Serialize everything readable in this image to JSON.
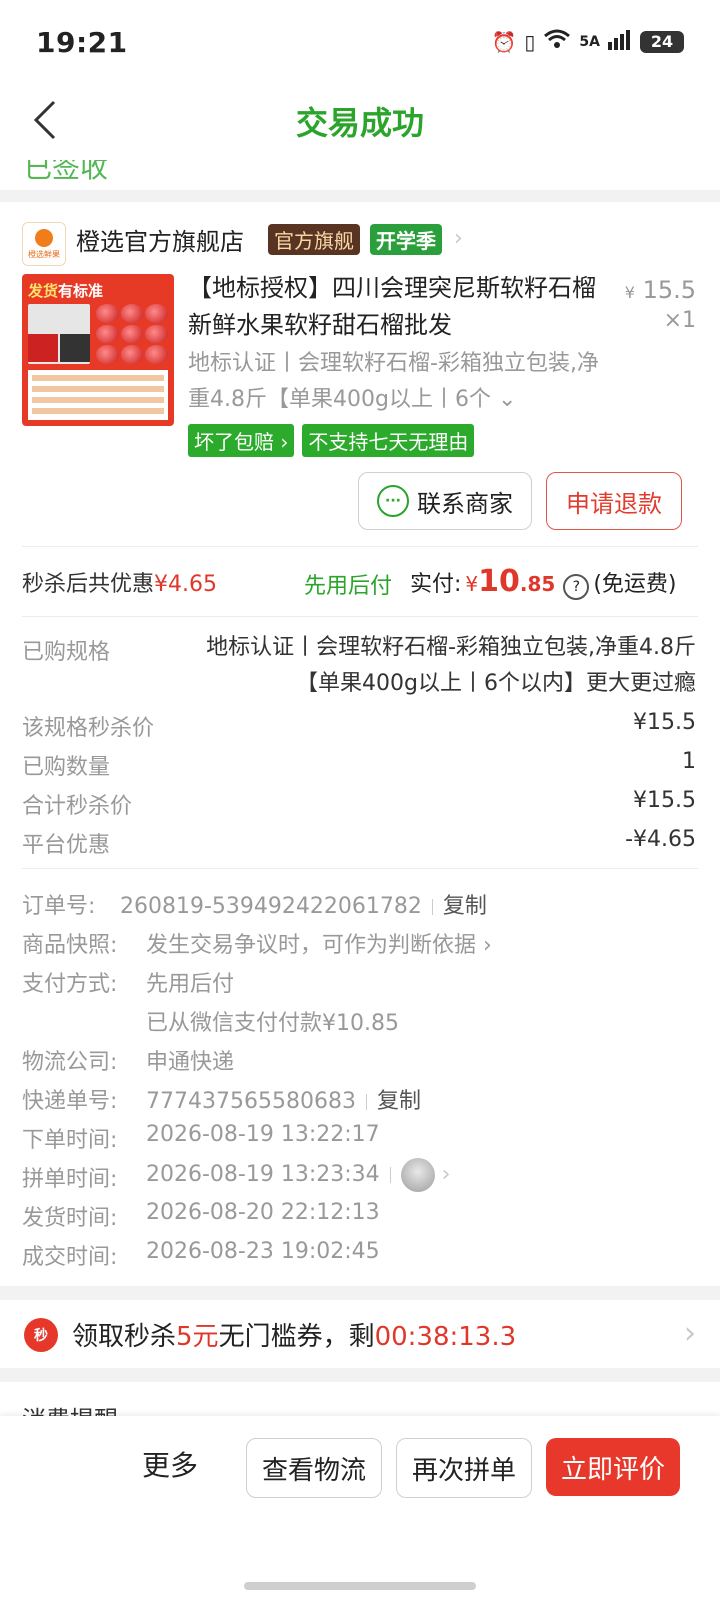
{
  "status_bar": {
    "time": "19:21",
    "network": "5A",
    "battery": "24"
  },
  "header": {
    "title": "交易成功",
    "peek_text": "已签收"
  },
  "store": {
    "logo_text": "橙选鲜果",
    "name": "橙选官方旗舰店",
    "badges": [
      "官方旗舰",
      "开学季"
    ]
  },
  "product": {
    "image_caption_a": "发货",
    "image_caption_b": "有标准",
    "title": "【地标授权】四川会理突尼斯软籽石榴新鲜水果软籽甜石榴批发",
    "price_symbol": "¥",
    "price": "15.5",
    "qty": "×1",
    "spec": "地标认证丨会理软籽石榴-彩箱独立包装,净重4.8斤【单果400g以上丨6个",
    "tags": [
      "坏了包赔 ›",
      "不支持七天无理由"
    ]
  },
  "actions": {
    "contact": "联系商家",
    "refund": "申请退款"
  },
  "summary": {
    "discount_label": "秒杀后共优惠",
    "discount_value": "¥4.65",
    "pay_later": "先用后付",
    "paid_label": "实付:",
    "paid_currency": "¥",
    "paid_int": "10",
    "paid_dec": ".85",
    "shipping": "(免运费)"
  },
  "details": {
    "spec_label": "已购规格",
    "spec_value": "地标认证丨会理软籽石榴-彩箱独立包装,净重4.8斤【单果400g以上丨6个以内】更大更过瘾",
    "rows": [
      {
        "label": "该规格秒杀价",
        "value": "¥15.5"
      },
      {
        "label": "已购数量",
        "value": "1"
      },
      {
        "label": "合计秒杀价",
        "value": "¥15.5"
      },
      {
        "label": "平台优惠",
        "value": "-¥4.65"
      }
    ]
  },
  "order": {
    "order_no_label": "订单号:",
    "order_no": "260819-539492422061782",
    "copy": "复制",
    "snapshot_label": "商品快照:",
    "snapshot_value": "发生交易争议时，可作为判断依据 ›",
    "payment_label": "支付方式:",
    "payment_value": "先用后付",
    "payment_note": "已从微信支付付款¥10.85",
    "logistics_label": "物流公司:",
    "logistics_value": "申通快递",
    "tracking_label": "快递单号:",
    "tracking_value": "777437565580683",
    "order_time_label": "下单时间:",
    "order_time": "2026-08-19 13:22:17",
    "group_time_label": "拼单时间:",
    "group_time": "2026-08-19 13:23:34",
    "ship_time_label": "发货时间:",
    "ship_time": "2026-08-20 22:12:13",
    "deal_time_label": "成交时间:",
    "deal_time": "2026-08-23 19:02:45"
  },
  "coupon": {
    "icon": "秒",
    "prefix": "领取秒杀",
    "amount": "5元",
    "middle": "无门槛券，剩",
    "countdown": "00:38:13.3"
  },
  "next_section": "消费提醒",
  "bottom_bar": {
    "more": "更多",
    "logistics": "查看物流",
    "regroup": "再次拼单",
    "review": "立即评价"
  },
  "colors": {
    "brand_green": "#2aa42a",
    "accent_red": "#e8382c"
  }
}
